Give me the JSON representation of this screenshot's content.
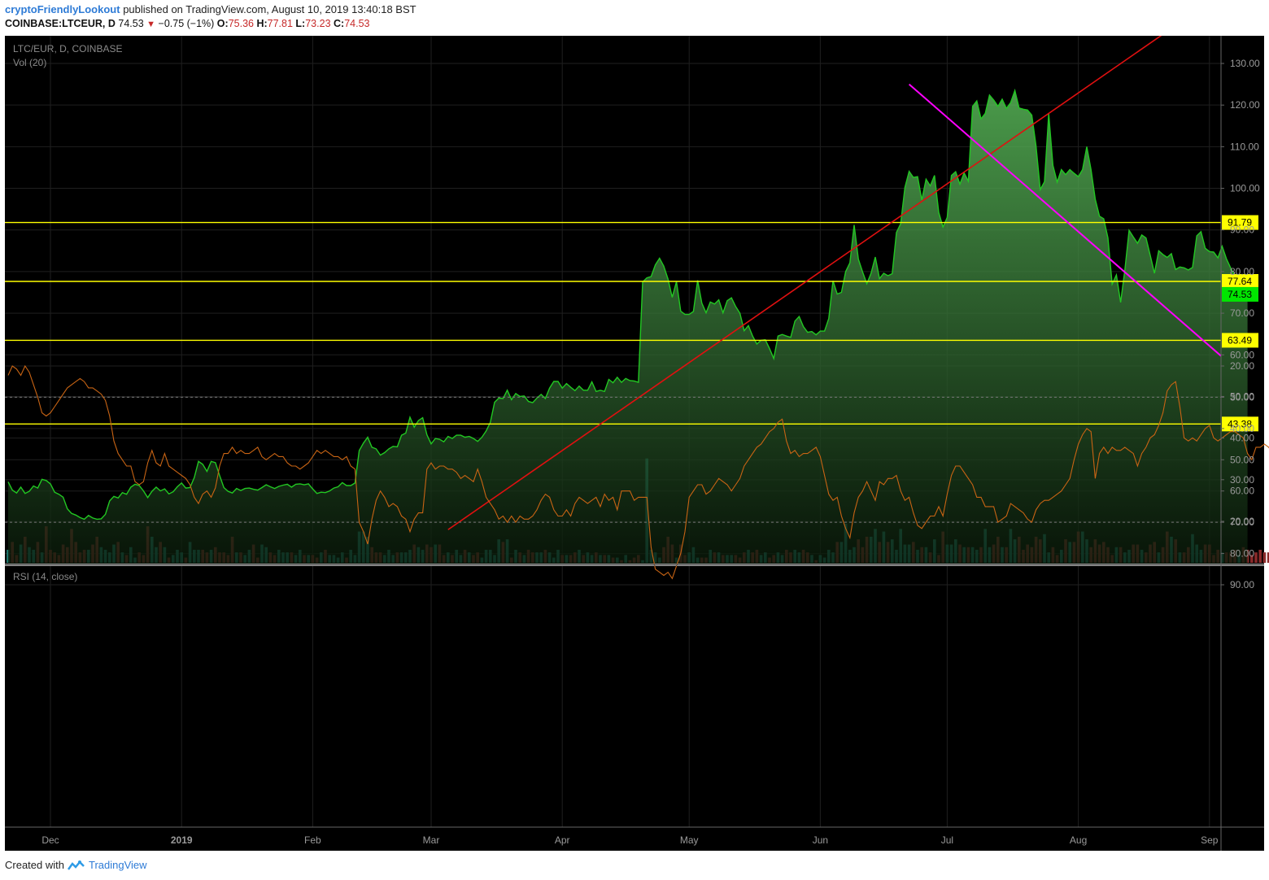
{
  "header": {
    "user": "cryptoFriendlyLookout",
    "published": "published on TradingView.com, August 10, 2019 13:40:18 BST",
    "symbol": "COINBASE:LTCEUR, D",
    "last": "74.53",
    "change": "−0.75 (−1%)",
    "o_label": "O:",
    "o": "75.36",
    "h_label": "H:",
    "h": "77.81",
    "l_label": "L:",
    "l": "73.23",
    "c_label": "C:",
    "c": "74.53"
  },
  "pane_labels": {
    "symbol": "LTC/EUR, D, COINBASE",
    "volume": "Vol (20)",
    "rsi": "RSI (14, close)"
  },
  "footer": {
    "created": "Created with",
    "brand": "TradingView"
  },
  "colors": {
    "price_line": "#22c722",
    "area_top": "#4caf50",
    "level": "#ffff00",
    "level_label_bg": "#ffff00",
    "last_price_bg": "#00e600",
    "trend_up": "#e01010",
    "trend_down": "#ff00ff",
    "vol_up": "#1d7c72",
    "vol_down": "#8a2a2a",
    "rsi_line": "#c86414",
    "rsi_band": "#14051e"
  },
  "chart_data": [
    {
      "type": "area",
      "title": "LTC/EUR, D, COINBASE",
      "x_range": [
        "2018-11-21",
        "2019-09-04"
      ],
      "x_ticks": [
        "Dec",
        "2019",
        "Feb",
        "Mar",
        "Apr",
        "May",
        "Jun",
        "Jul",
        "Aug",
        "Sep"
      ],
      "y_ticks": [
        20,
        30,
        40,
        50,
        60,
        70,
        80,
        90,
        100,
        110,
        120,
        130
      ],
      "ylim": [
        10,
        133
      ],
      "series": [
        {
          "start": "2018-11-21",
          "interval": "1D",
          "values": [
            29.5,
            27.5,
            26.8,
            28.2,
            26.7,
            27.2,
            28.5,
            28.0,
            30.1,
            29.8,
            29.0,
            27.0,
            26.5,
            25.8,
            23.0,
            21.9,
            21.5,
            20.9,
            20.5,
            21.4,
            20.8,
            20.5,
            20.6,
            21.7,
            24.9,
            26.0,
            25.6,
            26.9,
            26.5,
            28.2,
            28.9,
            28.6,
            27.3,
            25.7,
            27.2,
            28.2,
            27.3,
            27.8,
            26.6,
            27.1,
            28.3,
            29.2,
            28.0,
            28.1,
            30.5,
            34.4,
            33.7,
            32.0,
            34.4,
            34.1,
            31.0,
            28.1,
            27.2,
            26.8,
            27.9,
            27.4,
            27.9,
            28.0,
            27.7,
            27.5,
            28.1,
            28.8,
            28.3,
            27.9,
            28.4,
            28.7,
            28.9,
            28.2,
            28.9,
            29.0,
            28.8,
            29.0,
            27.8,
            26.7,
            27.0,
            26.9,
            27.3,
            28.0,
            28.3,
            29.3,
            28.6,
            28.6,
            29.2,
            37.0,
            38.8,
            40.2,
            37.8,
            37.4,
            35.9,
            36.5,
            37.4,
            38.0,
            37.9,
            40.7,
            41.2,
            45.0,
            42.6,
            44.2,
            44.9,
            40.8,
            38.6,
            39.9,
            39.7,
            39.1,
            40.4,
            39.9,
            40.7,
            40.7,
            40.2,
            40.4,
            39.9,
            39.2,
            40.2,
            41.7,
            43.8,
            48.6,
            49.6,
            49.5,
            51.5,
            49.2,
            50.7,
            50.0,
            50.1,
            48.8,
            48.5,
            49.6,
            50.5,
            49.5,
            52.0,
            53.6,
            53.6,
            52.0,
            53.1,
            52.2,
            51.4,
            52.5,
            51.5,
            51.5,
            53.5,
            51.2,
            51.5,
            51.2,
            54.1,
            53.3,
            54.6,
            53.4,
            54.3,
            53.8,
            53.7,
            53.4,
            77.5,
            78.5,
            78.8,
            81.6,
            83.2,
            81.3,
            78.2,
            73.8,
            77.6,
            70.5,
            69.7,
            69.7,
            70.4,
            77.9,
            72.4,
            70.1,
            72.7,
            72.2,
            73.2,
            70.1,
            73.0,
            73.7,
            71.6,
            70.0,
            65.8,
            67.0,
            64.5,
            62.6,
            63.5,
            63.6,
            61.5,
            59.1,
            64.5,
            64.9,
            64.5,
            64.2,
            68.1,
            69.2,
            66.8,
            65.4,
            65.6,
            64.8,
            65.7,
            65.7,
            68.7,
            77.8,
            74.6,
            75.0,
            80.0,
            82.1,
            91.2,
            83.0,
            79.9,
            77.1,
            79.6,
            83.5,
            78.3,
            79.6,
            79.0,
            79.5,
            89.4,
            91.5,
            100.2,
            104.1,
            102.6,
            102.8,
            97.2,
            102.2,
            100.6,
            103.1,
            94.2,
            90.7,
            93.0,
            103.1,
            104.0,
            101.0,
            103.7,
            101.7,
            119.7,
            121.0,
            116.7,
            118.0,
            122.4,
            121.2,
            119.7,
            121.4,
            119.2,
            120.6,
            123.5,
            119.3,
            119.0,
            118.8,
            117.6,
            110.2,
            99.7,
            101.6,
            117.9,
            105.5,
            101.5,
            104.5,
            103.3,
            104.5,
            103.6,
            102.8,
            104.5,
            110.0,
            104.5,
            97.4,
            93.3,
            92.7,
            88.1,
            77.0,
            79.2,
            72.6,
            80.4,
            89.9,
            88.3,
            86.8,
            88.8,
            88.1,
            83.9,
            79.6,
            85.0,
            84.1,
            83.4,
            84.3,
            80.5,
            81.1,
            80.9,
            80.4,
            81.0,
            88.6,
            89.6,
            85.6,
            84.8,
            84.7,
            83.3,
            86.1,
            83.1,
            80.9,
            78.9,
            79.1,
            75.4,
            74.53
          ]
        }
      ],
      "levels": [
        91.79,
        77.64,
        63.49,
        43.38
      ],
      "last_value": 74.53,
      "trendlines": [
        {
          "name": "up",
          "from": [
            "2019-03-05",
            18.0
          ],
          "to": [
            "2019-08-21",
            137.0
          ]
        },
        {
          "name": "down",
          "from": [
            "2019-06-22",
            125.0
          ],
          "to": [
            "2019-09-04",
            59.5
          ]
        }
      ]
    },
    {
      "type": "bar",
      "title": "Vol (20)",
      "values": [
        5,
        8,
        3,
        7,
        10,
        6,
        5,
        8,
        4,
        14,
        5,
        4,
        3,
        7,
        6,
        13,
        8,
        4,
        5,
        5,
        7,
        10,
        6,
        5,
        4,
        7,
        8,
        4,
        3,
        6,
        2,
        4,
        3,
        14,
        10,
        6,
        8,
        6,
        2,
        3,
        5,
        4,
        2,
        8,
        5,
        5,
        5,
        4,
        5,
        6,
        4,
        4,
        3,
        10,
        4,
        4,
        3,
        5,
        7,
        2,
        7,
        6,
        4,
        3,
        5,
        4,
        4,
        4,
        3,
        5,
        3,
        3,
        3,
        2,
        4,
        5,
        3,
        3,
        2,
        4,
        2,
        5,
        3,
        12,
        12,
        10,
        6,
        4,
        4,
        3,
        5,
        3,
        4,
        4,
        4,
        5,
        7,
        6,
        5,
        7,
        6,
        7,
        7,
        3,
        4,
        3,
        5,
        3,
        5,
        4,
        3,
        4,
        2,
        5,
        5,
        3,
        9,
        8,
        9,
        2,
        5,
        4,
        3,
        5,
        4,
        4,
        4,
        5,
        4,
        2,
        5,
        3,
        3,
        3,
        4,
        5,
        3,
        4,
        3,
        4,
        3,
        3,
        3,
        2,
        2,
        1,
        3,
        1,
        2,
        3,
        1,
        40,
        5,
        4,
        2,
        6,
        10,
        7,
        2,
        7,
        3,
        4,
        6,
        2,
        2,
        2,
        5,
        4,
        4,
        3,
        3,
        3,
        3,
        2,
        4,
        5,
        4,
        5,
        3,
        4,
        2,
        3,
        4,
        3,
        5,
        4,
        5,
        4,
        5,
        4,
        3,
        1,
        3,
        2,
        5,
        4,
        8,
        8,
        15,
        5,
        6,
        9,
        6,
        10,
        10,
        13,
        8,
        12,
        8,
        9,
        5,
        13,
        7,
        7,
        8,
        5,
        6,
        6,
        4,
        9,
        3,
        12,
        7,
        7,
        9,
        7,
        6,
        6,
        6,
        5,
        6,
        13,
        6,
        7,
        10,
        6,
        6,
        13,
        9,
        10,
        5,
        7,
        6,
        10,
        9,
        11,
        4,
        6,
        3,
        5,
        9,
        8,
        8,
        12,
        12,
        9,
        6,
        9,
        7,
        8,
        6,
        3,
        6,
        6,
        4,
        5,
        7,
        7,
        5,
        4,
        7,
        8,
        4,
        6,
        12,
        10,
        9,
        4,
        4,
        6,
        11,
        7,
        5,
        7,
        7,
        3,
        5,
        4,
        4,
        4,
        5,
        3,
        6,
        5,
        3,
        4,
        5,
        4,
        4,
        3,
        4,
        5,
        3,
        3,
        4,
        3,
        3,
        6,
        3,
        4,
        4,
        4,
        5,
        3,
        4,
        4,
        5,
        3,
        4,
        3
      ],
      "colors_up_down": "per-bar (teal = up, maroon = down)"
    },
    {
      "type": "line",
      "title": "RSI (14, close)",
      "y_ticks": [
        20,
        30,
        40,
        50,
        60,
        70,
        80,
        90
      ],
      "ylim": [
        12,
        95
      ],
      "band": [
        30,
        70
      ],
      "values": [
        23,
        20,
        21,
        23,
        20,
        22,
        26,
        30,
        35,
        36,
        35,
        33,
        31,
        29,
        27,
        26,
        25,
        24,
        25,
        27,
        27,
        28,
        29,
        31,
        36,
        44,
        48,
        50,
        52,
        52,
        57,
        58,
        57,
        51,
        47,
        51,
        52,
        48,
        52,
        53,
        54,
        55,
        56,
        58,
        62,
        64,
        61,
        60,
        62,
        59,
        52,
        48,
        48,
        46,
        48,
        47,
        48,
        48,
        47,
        46,
        49,
        50,
        49,
        48,
        49,
        49,
        51,
        52,
        52,
        53,
        52,
        51,
        49,
        47,
        48,
        47,
        48,
        49,
        49,
        50,
        49,
        52,
        53,
        70,
        73,
        77,
        69,
        63,
        60,
        62,
        65,
        64,
        65,
        68,
        69,
        73,
        69,
        67,
        67,
        53,
        51,
        53,
        52,
        52,
        53,
        53,
        54,
        56,
        55,
        56,
        57,
        53,
        57,
        62,
        64,
        66,
        69,
        68,
        70,
        68,
        70,
        68,
        69,
        69,
        68,
        66,
        63,
        61,
        62,
        66,
        68,
        68,
        66,
        68,
        64,
        62,
        63,
        64,
        63,
        62,
        65,
        61,
        63,
        62,
        66,
        60,
        60,
        60,
        63,
        62,
        62,
        62,
        78,
        85,
        86,
        87,
        86,
        88,
        84,
        80,
        73,
        62,
        60,
        58,
        58,
        61,
        60,
        58,
        56,
        57,
        58,
        60,
        58,
        56,
        52,
        50,
        48,
        46,
        45,
        43,
        41,
        40,
        38,
        37,
        44,
        48,
        47,
        49,
        48,
        48,
        47,
        46,
        49,
        55,
        61,
        63,
        62,
        68,
        72,
        75,
        67,
        62,
        60,
        57,
        60,
        63,
        57,
        58,
        56,
        56,
        55,
        60,
        63,
        62,
        67,
        71,
        72,
        70,
        68,
        68,
        65,
        68,
        61,
        55,
        52,
        52,
        54,
        56,
        58,
        62,
        62,
        65,
        65,
        65,
        70,
        69,
        68,
        64,
        65,
        66,
        67,
        69,
        70,
        66,
        64,
        63,
        63,
        62,
        61,
        60,
        58,
        56,
        50,
        45,
        42,
        40,
        41,
        56,
        48,
        46,
        48,
        46,
        47,
        47,
        46,
        47,
        48,
        52,
        48,
        46,
        43,
        42,
        39,
        35,
        28,
        26,
        25,
        33,
        43,
        44,
        43,
        44,
        42,
        40,
        39,
        43,
        44,
        43,
        42,
        41,
        41,
        42,
        43,
        48,
        50,
        46,
        46,
        45,
        46,
        48,
        45,
        43,
        42,
        41,
        40,
        36,
        35
      ]
    }
  ]
}
